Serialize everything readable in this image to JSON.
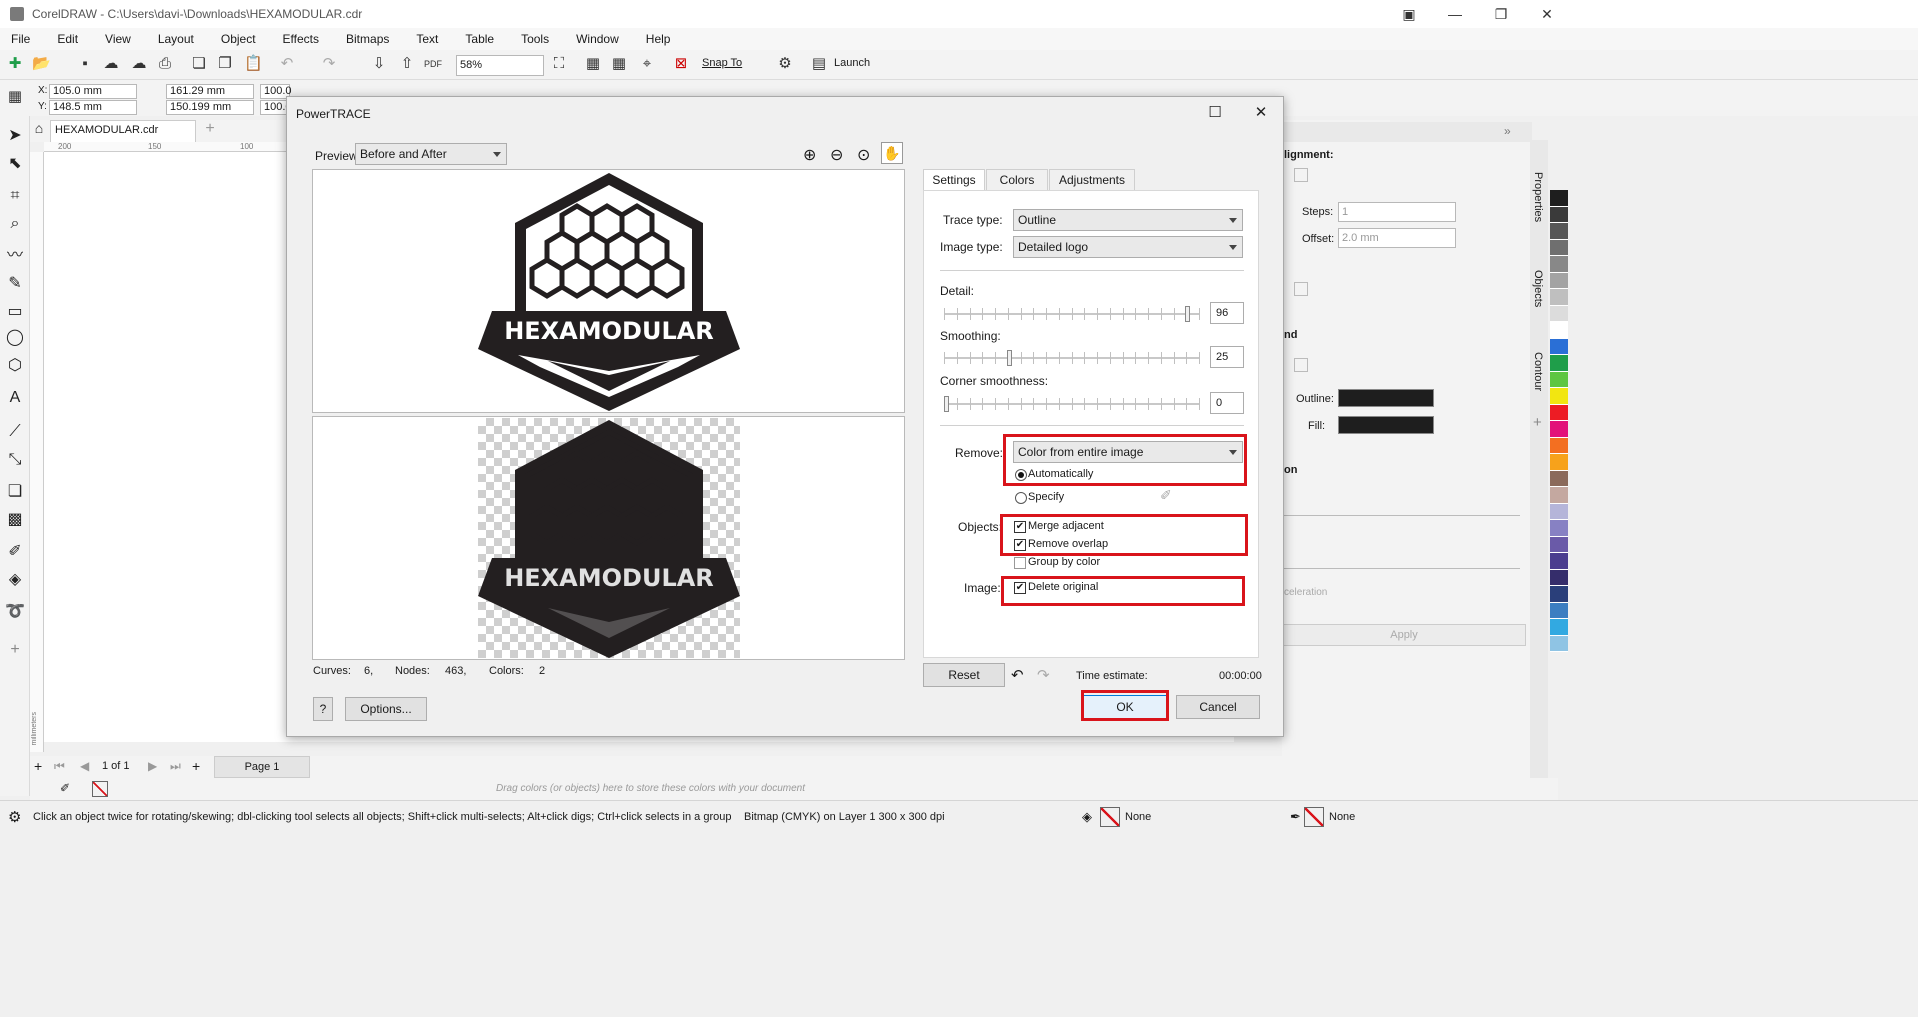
{
  "app": {
    "title": "CorelDRAW - C:\\Users\\davi-\\Downloads\\HEXAMODULAR.cdr",
    "menu": [
      "File",
      "Edit",
      "View",
      "Layout",
      "Object",
      "Effects",
      "Bitmaps",
      "Text",
      "Table",
      "Tools",
      "Window",
      "Help"
    ],
    "zoom": "58%",
    "snap_to": "Snap To",
    "launch": "Launch",
    "x_value": "105.0 mm",
    "y_value": "148.5 mm",
    "w_value": "161.29 mm",
    "h_value": "150.199 mm",
    "sx_value": "100.0",
    "sy_value": "100.0",
    "x_label": "X:",
    "y_label": "Y:",
    "doc_tab": "HEXAMODULAR.cdr",
    "ruler_ticks": [
      "200",
      "150",
      "100"
    ],
    "ruler_unit": "millimeters"
  },
  "right_panel": {
    "alignment_title": "lignment:",
    "steps_label": "Steps:",
    "steps_value": "1",
    "offset_label": "Offset:",
    "offset_value": "2.0 mm",
    "section2": "nd",
    "outline_label": "Outline:",
    "fill_label": "Fill:",
    "section3": "on",
    "acceleration": "celeration",
    "apply": "Apply",
    "tabs": [
      "Properties",
      "Objects",
      "Contour"
    ]
  },
  "page_nav": {
    "page_count": "1 of 1",
    "page_tab": "Page 1",
    "drag_hint": "Drag colors (or objects) here to store these colors with your document"
  },
  "status": {
    "hint": "Click an object twice for rotating/skewing; dbl-clicking tool selects all objects; Shift+click multi-selects; Alt+click digs; Ctrl+click selects in a group",
    "object_info": "Bitmap (CMYK) on Layer 1  300 x 300 dpi",
    "fill_none": "None",
    "outline_none": "None"
  },
  "dialog": {
    "title": "PowerTRACE",
    "preview_label": "Preview:",
    "preview_value": "Before and After",
    "logo_text": "HEXAMODULAR",
    "tabs": [
      "Settings",
      "Colors",
      "Adjustments"
    ],
    "trace_type_label": "Trace type:",
    "trace_type": "Outline",
    "image_type_label": "Image type:",
    "image_type": "Detailed logo",
    "detail_label": "Detail:",
    "detail_value": "96",
    "detail": 0.96,
    "smoothing_label": "Smoothing:",
    "smoothing_value": "25",
    "smoothing": 0.25,
    "corner_label": "Corner smoothness:",
    "corner_value": "0",
    "corner": 0.0,
    "remove_label": "Remove:",
    "remove_value": "Color from entire image",
    "auto_label": "Automatically",
    "specify_label": "Specify",
    "objects_label": "Objects:",
    "merge_label": "Merge adjacent",
    "overlap_label": "Remove overlap",
    "group_label": "Group by color",
    "image_label": "Image:",
    "delete_label": "Delete original",
    "curves_label": "Curves:",
    "curves_value": "6,",
    "nodes_label": "Nodes:",
    "nodes_value": "463,",
    "colors_label": "Colors:",
    "colors_value": "2",
    "reset": "Reset",
    "time_label": "Time estimate:",
    "time_value": "00:00:00",
    "help": "?",
    "options": "Options...",
    "ok": "OK",
    "cancel": "Cancel"
  },
  "colors": {
    "highlight": "#d9141b",
    "palette": [
      "#1e1e1e",
      "#3a3a3a",
      "#575757",
      "#6f6f6f",
      "#888888",
      "#a3a3a3",
      "#bfbfbf",
      "#dcdcdc",
      "#ffffff",
      "#2a6fd6",
      "#1f9e4a",
      "#5ec641",
      "#f2e611",
      "#ed1c24",
      "#e2127a",
      "#f36f21",
      "#f7a21b",
      "#8b6a5b",
      "#c4a8a0",
      "#b5b5d9",
      "#8781c3",
      "#6a5aa8",
      "#4b3d8f",
      "#352d6b",
      "#2a3f7a",
      "#3c7ec1",
      "#32a9e1",
      "#8fc4e4"
    ]
  }
}
